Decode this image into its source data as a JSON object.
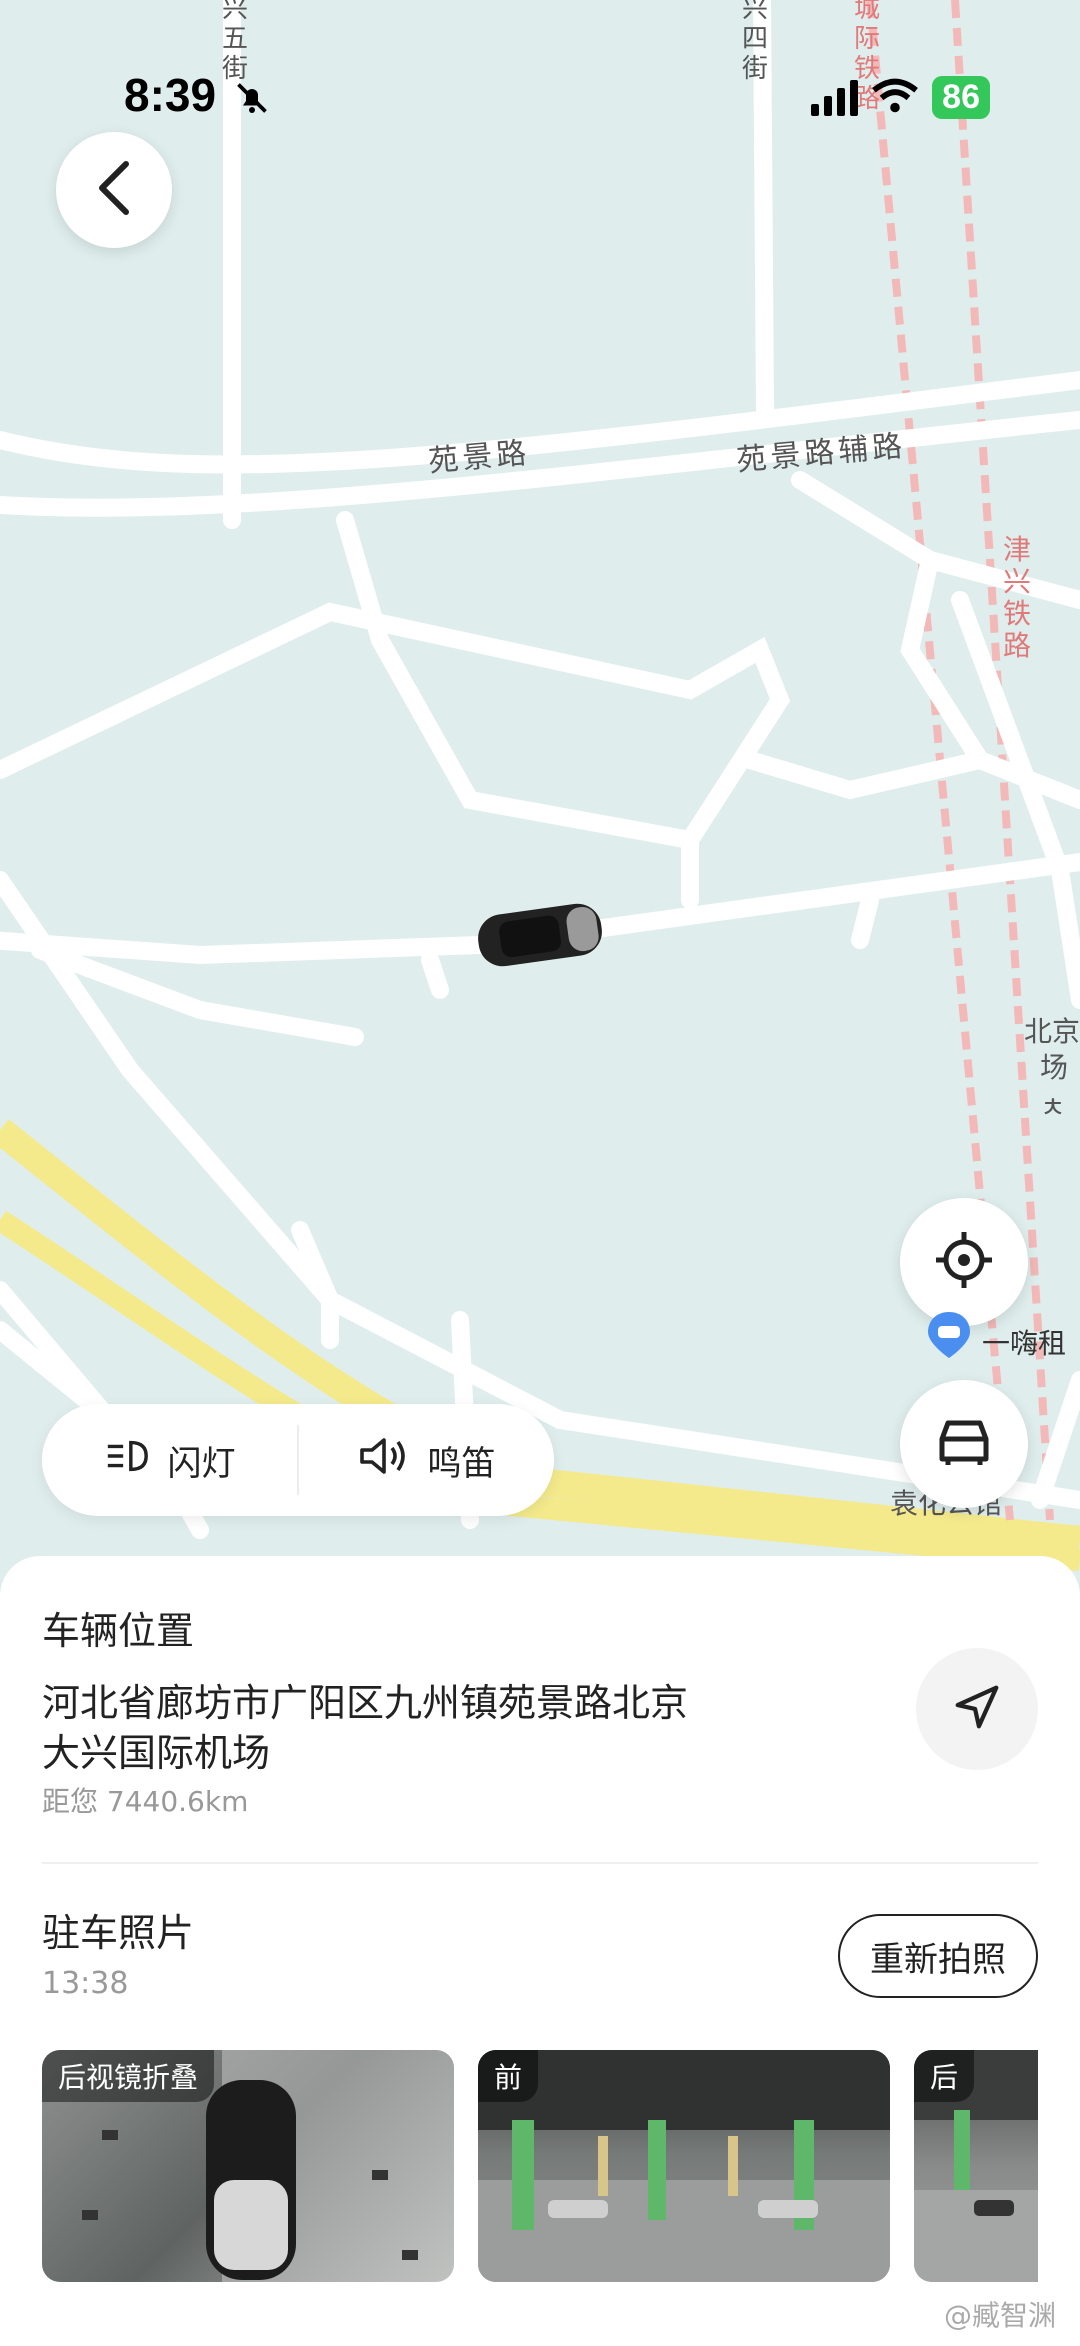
{
  "status": {
    "time": "8:39",
    "battery": "86"
  },
  "map": {
    "road_labels": [
      "苑景路",
      "苑景路辅路",
      "津兴铁路",
      "城际铁路",
      "兴五街",
      "兴四街",
      "北京",
      "场ㅊ"
    ],
    "poi": "一嗨租",
    "poi_bottom": "袁化公馆"
  },
  "actions": {
    "flash_label": "闪灯",
    "horn_label": "鸣笛"
  },
  "vehicle": {
    "section_title": "车辆位置",
    "address_line1": "河北省廊坊市广阳区九州镇苑景路北京",
    "address_line2": "大兴国际机场",
    "distance": "距您 7440.6km"
  },
  "parking": {
    "title": "驻车照片",
    "time": "13:38",
    "retake_label": "重新拍照",
    "photos": [
      {
        "label": "后视镜折叠"
      },
      {
        "label": "前"
      },
      {
        "label": "后"
      }
    ]
  },
  "watermark": "@臧智渊",
  "colors": {
    "map_bg": "#dfeeed",
    "road": "#ffffff",
    "highway": "#f4ea8c",
    "rail": "#f3b9b9",
    "accent": "#34c759"
  },
  "icons": [
    "back-icon",
    "locate-icon",
    "car-outline-icon",
    "headlight-icon",
    "speaker-icon",
    "navigate-arrow-icon",
    "bell-off-icon",
    "wifi-icon",
    "car-marker-icon"
  ]
}
